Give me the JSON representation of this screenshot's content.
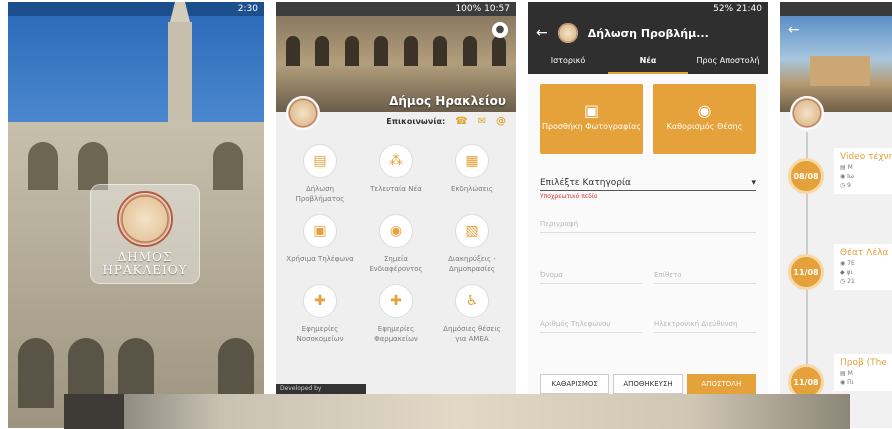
{
  "screen1": {
    "status": {
      "time": "2:30"
    },
    "logo_lines": [
      "ΔΗΜΟΣ",
      "ΗΡΑΚΛΕΙΟΥ"
    ]
  },
  "screen2": {
    "status": {
      "battery": "100%",
      "time": "10:57"
    },
    "title": "Δήμος Ηρακλείου",
    "contact_label": "Επικοινωνία:",
    "tiles": [
      {
        "label": "Δήλωση Προβλήματος",
        "icon": "chat-icon"
      },
      {
        "label": "Τελευταία Νέα",
        "icon": "rss-icon"
      },
      {
        "label": "Εκδηλώσεις",
        "icon": "calendar-icon"
      },
      {
        "label": "Χρήσιμα Τηλέφωνα",
        "icon": "book-icon"
      },
      {
        "label": "Σημεία Ενδιαφέροντος",
        "icon": "pin-icon"
      },
      {
        "label": "Διακηρύξεις - Δημοπρασίες",
        "icon": "clipboard-icon"
      },
      {
        "label": "Εφημερίες Νοσοκομείων",
        "icon": "hospital-icon"
      },
      {
        "label": "Εφημερίες Φαρμακείων",
        "icon": "pharmacy-icon"
      },
      {
        "label": "Δημόσιες θέσεις για ΑΜΕΑ",
        "icon": "wheelchair-icon"
      }
    ],
    "developed_by": "Developed by"
  },
  "screen3": {
    "status": {
      "battery": "52%",
      "time": "21:40"
    },
    "title": "Δήλωση Προβλήμ...",
    "tabs": [
      "Ιστορικό",
      "Νέα",
      "Προς Αποστολή"
    ],
    "actions": [
      {
        "label": "Προσθήκη Φωτογραφίας",
        "icon": "image-icon"
      },
      {
        "label": "Καθορισμός Θέσης",
        "icon": "pin-icon"
      }
    ],
    "category_label": "Επιλέξτε Κατηγορία",
    "required_note": "Υποχρεωτικό πεδίο",
    "fields": {
      "description": "Περιγραφή",
      "name": "Όνομα",
      "surname": "Επίθετο",
      "phone": "Αριθμός Τηλεφώνου",
      "email": "Ηλεκτρονική Διεύθυνση"
    },
    "buttons": {
      "clear": "ΚΑΘΑΡΙΣΜΟΣ",
      "save": "ΑΠΟΘΗΚΕΥΣΗ",
      "send": "ΑΠΟΣΤΟΛΗ"
    }
  },
  "screen4": {
    "items": [
      {
        "date": "08/08",
        "title": "Video τέχνη"
      },
      {
        "date": "11/08",
        "title": "Θέατ Λέλα"
      },
      {
        "date": "11/08",
        "title": "Προβ (The"
      }
    ]
  },
  "colors": {
    "accent": "#e5a13a",
    "dark_bar": "#2f2f2f"
  }
}
